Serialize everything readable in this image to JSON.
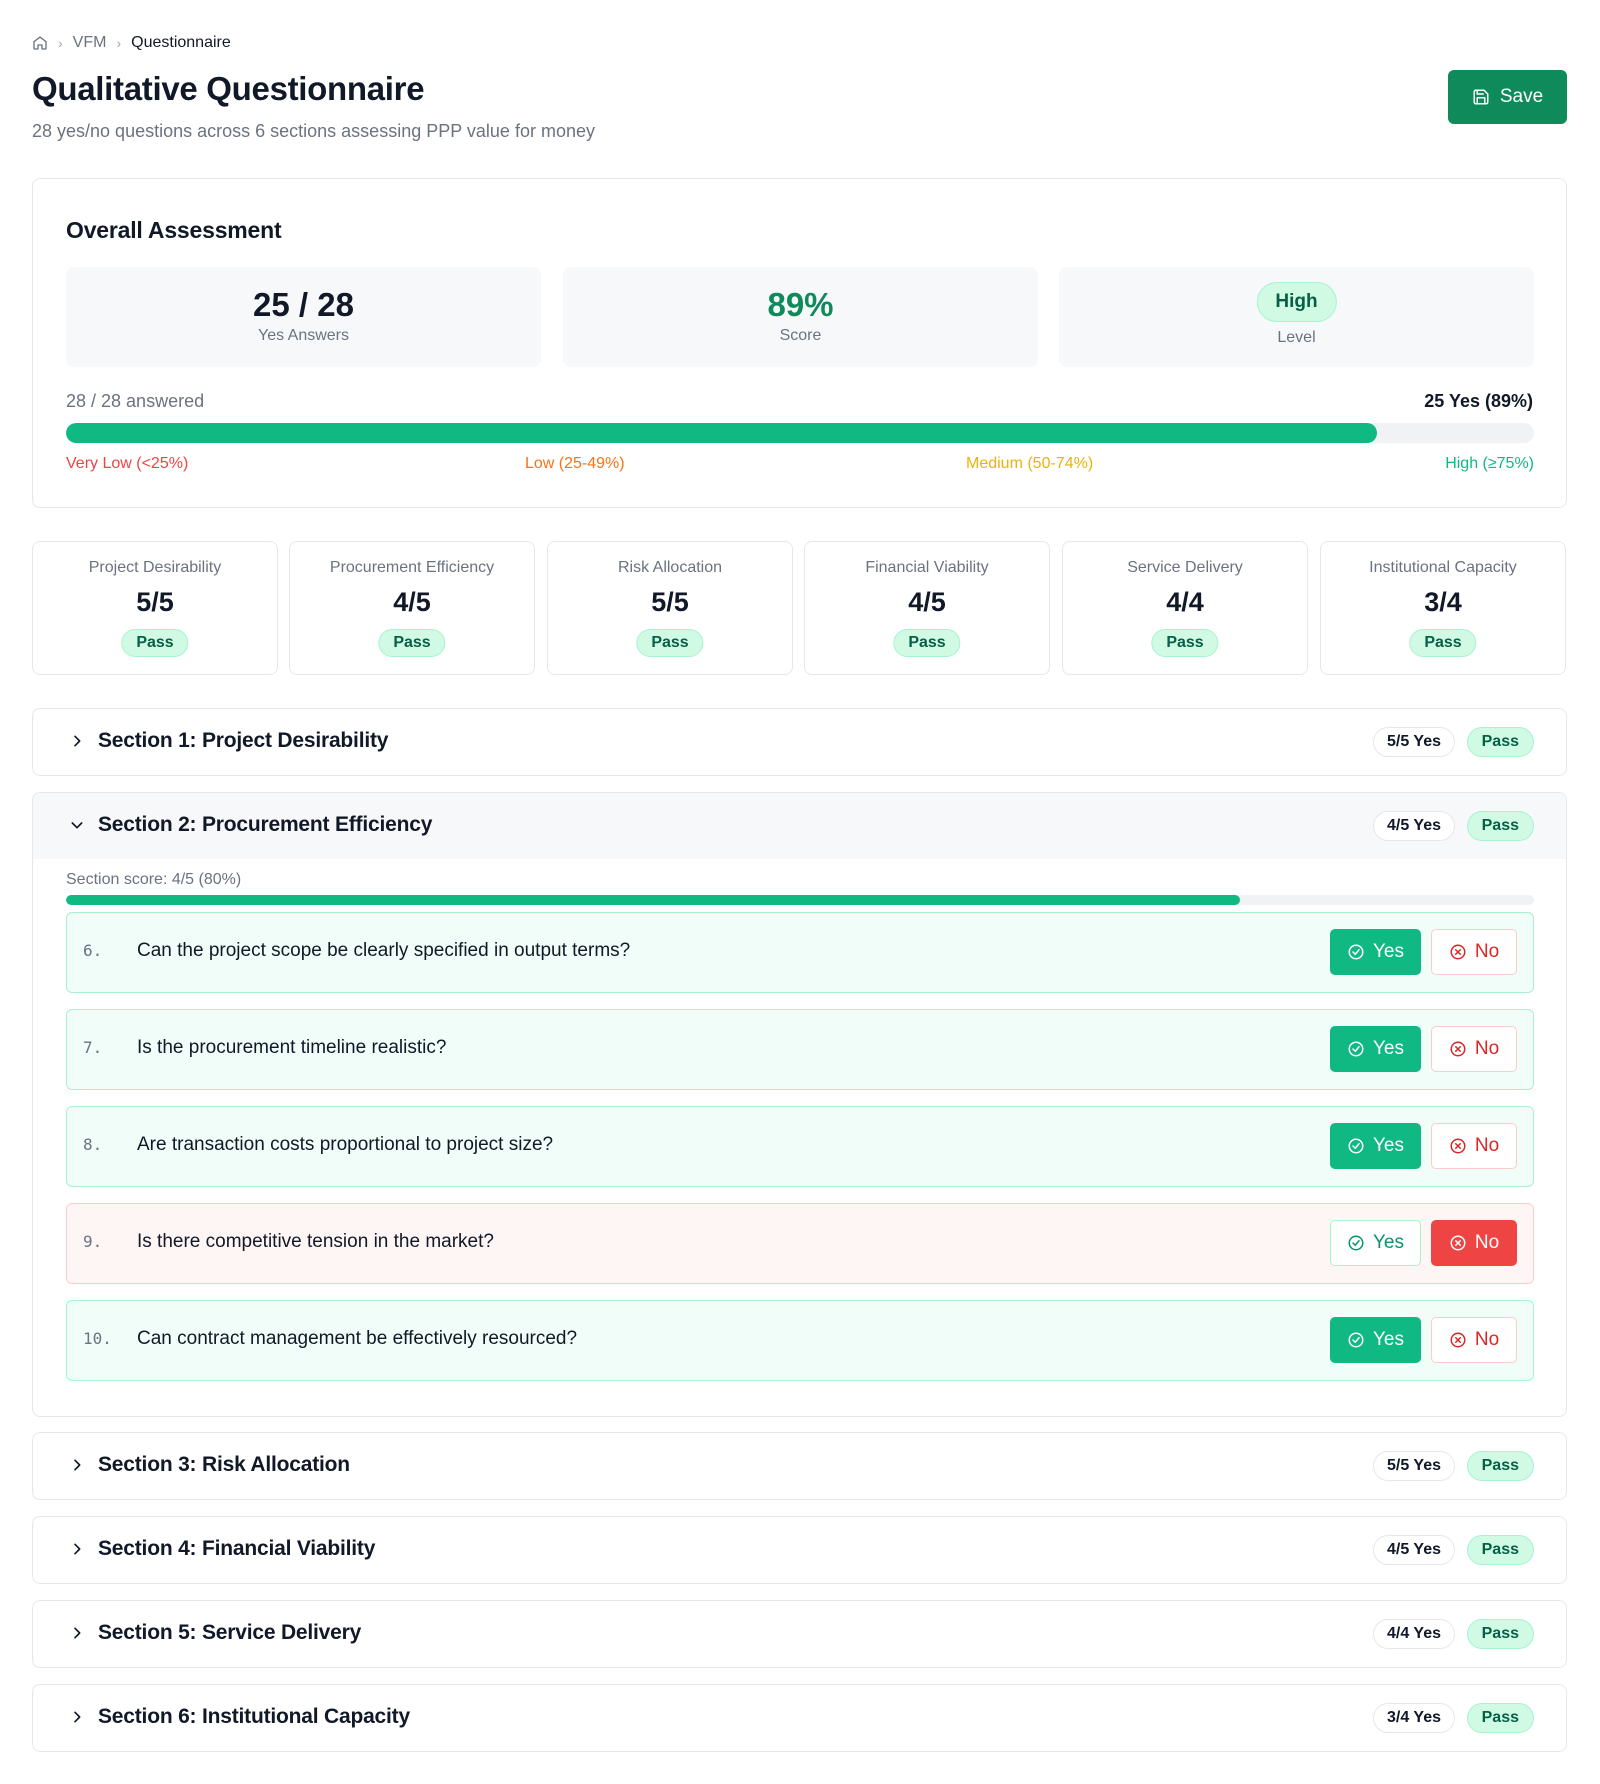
{
  "breadcrumb": {
    "items": [
      "VFM",
      "Questionnaire"
    ]
  },
  "header": {
    "title": "Qualitative Questionnaire",
    "subtitle": "28 yes/no questions across 6 sections assessing PPP value for money",
    "save_label": "Save"
  },
  "overall": {
    "heading": "Overall Assessment",
    "yes_answers": "25 / 28",
    "yes_answers_label": "Yes Answers",
    "score": "89%",
    "score_label": "Score",
    "level": "High",
    "level_label": "Level",
    "answered": "28 / 28 answered",
    "yes_summary": "25 Yes (89%)",
    "progress_fraction": 0.893,
    "legend": {
      "very_low": "Very Low (<25%)",
      "low": "Low (25-49%)",
      "medium": "Medium (50-74%)",
      "high": "High (≥75%)"
    }
  },
  "section_cards": [
    {
      "name": "Project Desirability",
      "value": "5/5",
      "status": "Pass"
    },
    {
      "name": "Procurement Efficiency",
      "value": "4/5",
      "status": "Pass"
    },
    {
      "name": "Risk Allocation",
      "value": "5/5",
      "status": "Pass"
    },
    {
      "name": "Financial Viability",
      "value": "4/5",
      "status": "Pass"
    },
    {
      "name": "Service Delivery",
      "value": "4/4",
      "status": "Pass"
    },
    {
      "name": "Institutional Capacity",
      "value": "3/4",
      "status": "Pass"
    }
  ],
  "sections": [
    {
      "title": "Section 1: Project Desirability",
      "yes": "5/5 Yes",
      "status": "Pass"
    },
    {
      "title": "Section 2: Procurement Efficiency",
      "yes": "4/5 Yes",
      "status": "Pass"
    },
    {
      "title": "Section 3: Risk Allocation",
      "yes": "5/5 Yes",
      "status": "Pass"
    },
    {
      "title": "Section 4: Financial Viability",
      "yes": "4/5 Yes",
      "status": "Pass"
    },
    {
      "title": "Section 5: Service Delivery",
      "yes": "4/4 Yes",
      "status": "Pass"
    },
    {
      "title": "Section 6: Institutional Capacity",
      "yes": "3/4 Yes",
      "status": "Pass"
    }
  ],
  "expanded_section": {
    "score_text": "Section score: 4/5 (80%)",
    "score_fraction": 0.8,
    "yes_label": "Yes",
    "no_label": "No",
    "questions": [
      {
        "num": "6.",
        "text": "Can the project scope be clearly specified in output terms?",
        "answer": "yes"
      },
      {
        "num": "7.",
        "text": "Is the procurement timeline realistic?",
        "answer": "yes"
      },
      {
        "num": "8.",
        "text": "Are transaction costs proportional to project size?",
        "answer": "yes"
      },
      {
        "num": "9.",
        "text": "Is there competitive tension in the market?",
        "answer": "no"
      },
      {
        "num": "10.",
        "text": "Can contract management be effectively resourced?",
        "answer": "yes"
      }
    ]
  },
  "colors": {
    "brand": "#0f8a5b",
    "accent": "#10b981",
    "danger": "#ef4444",
    "very_low": "#ef4444",
    "low": "#f97316",
    "medium": "#eab308",
    "high": "#10b981"
  }
}
